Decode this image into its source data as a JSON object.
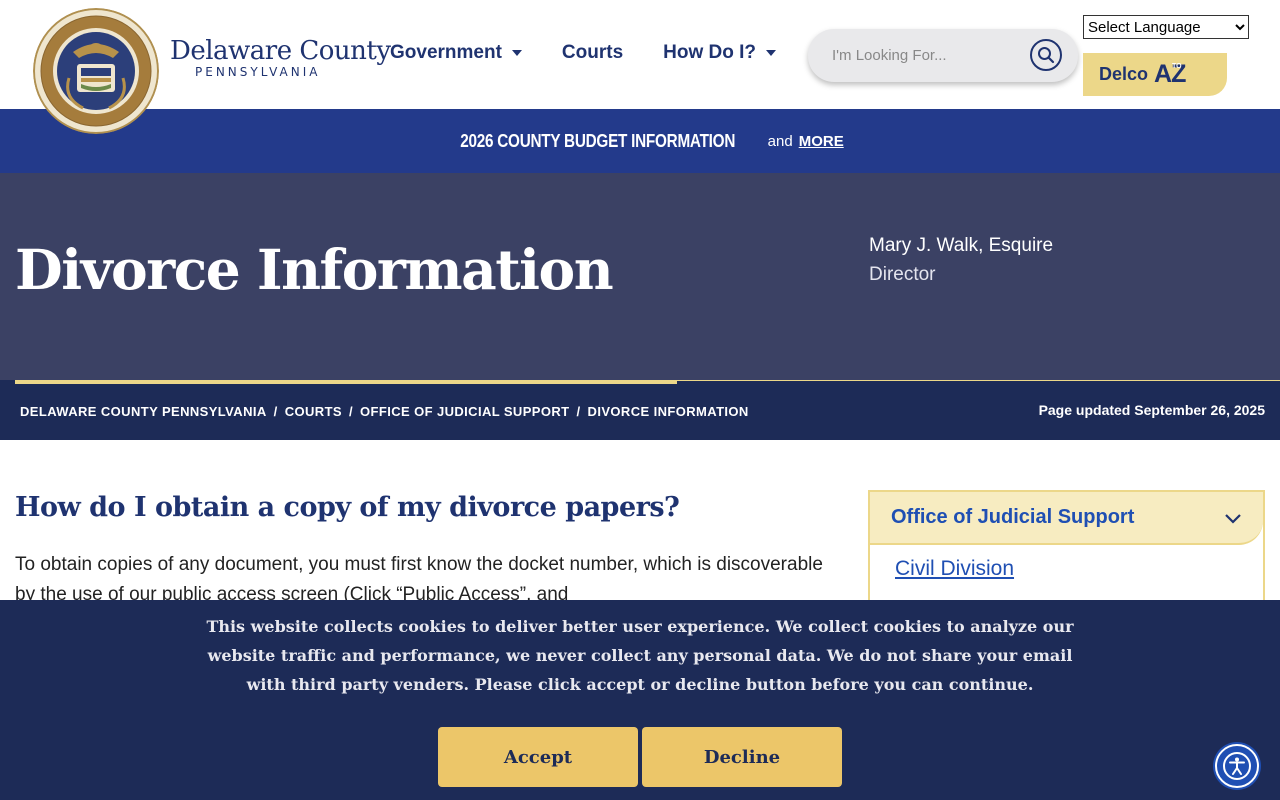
{
  "header": {
    "brand_name": "Delaware County",
    "brand_sub": "PENNSYLVANIA",
    "nav": [
      {
        "label": "Government",
        "dropdown": true
      },
      {
        "label": "Courts",
        "dropdown": false
      },
      {
        "label": "How Do I?",
        "dropdown": true
      }
    ],
    "search_placeholder": "I'm Looking For...",
    "language_select": "Select Language",
    "az_label": "Delco",
    "az_mark": "AZ",
    "az_to": "TO"
  },
  "banner": {
    "title": "2026 COUNTY BUDGET INFORMATION",
    "and": "and",
    "more": "MORE"
  },
  "hero": {
    "title": "Divorce Information",
    "director_name": "Mary J. Walk, Esquire",
    "director_role": "Director"
  },
  "breadcrumb": {
    "items": [
      "DELAWARE COUNTY PENNSYLVANIA",
      "COURTS",
      "OFFICE OF JUDICIAL SUPPORT",
      "DIVORCE INFORMATION"
    ],
    "separator": "/",
    "updated": "Page updated September 26, 2025"
  },
  "main": {
    "question": "How do I obtain a copy of my divorce papers?",
    "body": "To obtain copies of any document, you must first know the docket number, which is discoverable by the use of our public access screen (Click “Public Access”, and"
  },
  "sidebar": {
    "heading": "Office of Judicial Support",
    "links": [
      "Civil Division"
    ]
  },
  "cookie": {
    "text": "This website collects cookies to deliver better user experience. We collect cookies to analyze our website traffic and performance, we never collect any personal data. We do not share your email with third party venders. Please click accept or decline button before you can continue.",
    "accept": "Accept",
    "decline": "Decline"
  },
  "colors": {
    "navy": "#1f3370",
    "banner_blue": "#233a8b",
    "hero_bg": "#3b4164",
    "dark_navy": "#1d2b57",
    "gold": "#ecd789",
    "button_gold": "#ecc669",
    "link_blue": "#1f4fb3"
  }
}
